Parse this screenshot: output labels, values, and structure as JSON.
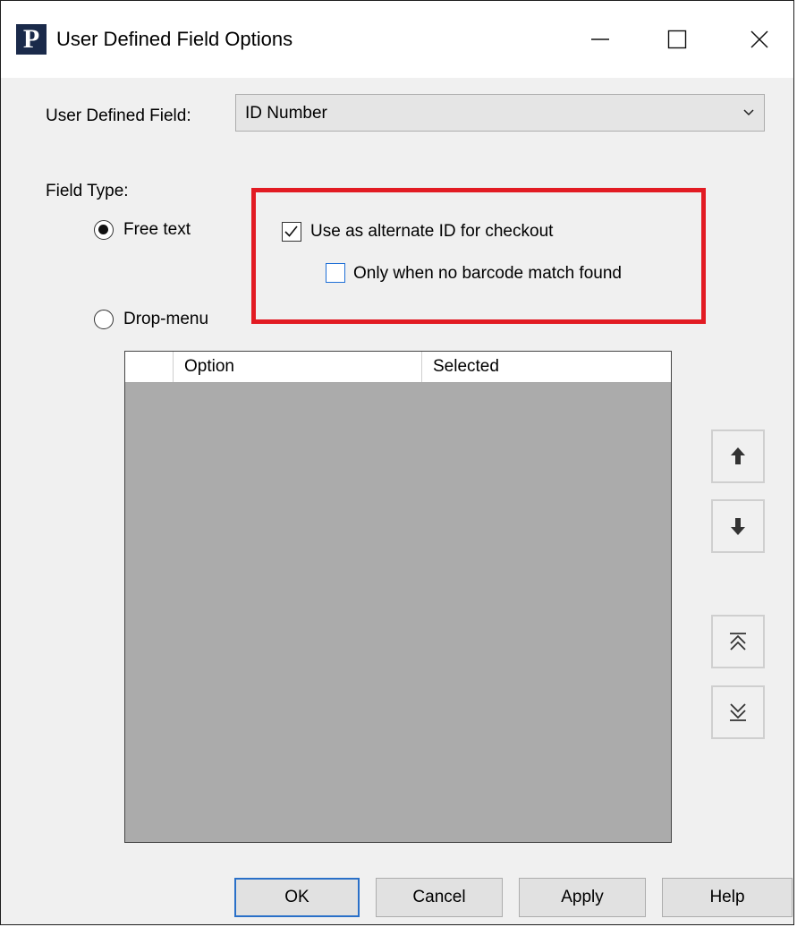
{
  "window": {
    "title": "User Defined Field Options",
    "app_icon_letter": "P",
    "controls": [
      "minimize-icon",
      "maximize-icon",
      "close-icon"
    ]
  },
  "udf": {
    "label": "User Defined Field:",
    "selected": "ID Number"
  },
  "field_type": {
    "label": "Field Type:",
    "options": [
      {
        "label": "Free text",
        "selected": true
      },
      {
        "label": "Drop-menu",
        "selected": false
      }
    ]
  },
  "alt_id": {
    "use_label": "Use as alternate ID for checkout",
    "use_checked": true,
    "only_label": "Only when no barcode match found",
    "only_checked": false,
    "highlight_color": "#e21b23"
  },
  "grid": {
    "columns": [
      "",
      "Option",
      "Selected"
    ],
    "rows": []
  },
  "side_buttons": [
    "move-up-icon",
    "move-down-icon",
    "move-to-top-icon",
    "move-to-bottom-icon"
  ],
  "buttons": {
    "ok": "OK",
    "cancel": "Cancel",
    "apply": "Apply",
    "help": "Help"
  }
}
